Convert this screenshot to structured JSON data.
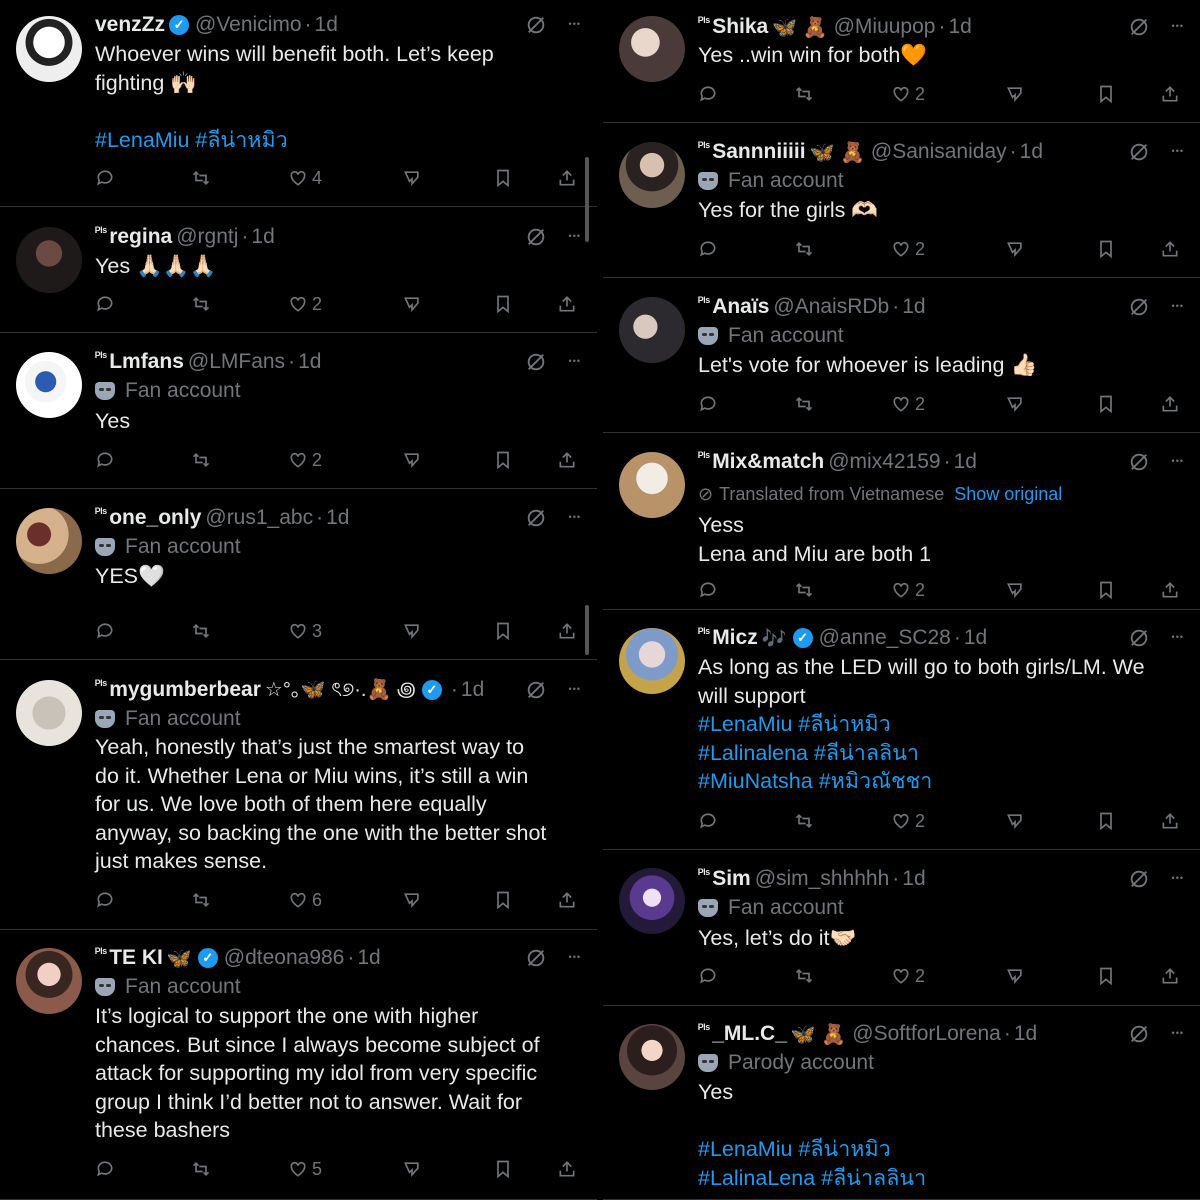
{
  "colors": {
    "background": "#000000",
    "text": "#e7e9ea",
    "muted": "#71767b",
    "accent": "#1d9bf0",
    "divider": "#2f3336"
  },
  "icons": [
    "reply-icon",
    "repost-icon",
    "like-icon",
    "stats-icon",
    "bookmark-icon",
    "share-icon",
    "grok-icon",
    "more-icon",
    "verified-icon",
    "fan-mask-icon"
  ],
  "pls_label": "ᴾˡˢ",
  "left": [
    {
      "name": "venzZz",
      "verified": true,
      "emoji": "",
      "handle": "@Venicimo",
      "time": "1d",
      "badge": "",
      "body_lines": [
        "Whoever wins will benefit both. Let’s keep",
        "fighting 🙌🏻",
        "",
        "#LenaMiu #ลีน่าหมิว"
      ],
      "likes": "4"
    },
    {
      "name": "regina",
      "verified": false,
      "emoji": "",
      "handle": "@rgntj",
      "time": "1d",
      "badge": "",
      "body_lines": [
        "Yes 🙏🏻🙏🏻🙏🏻"
      ],
      "likes": "2"
    },
    {
      "name": "Lmfans",
      "verified": false,
      "emoji": "",
      "handle": "@LMFans",
      "time": "1d",
      "badge": "Fan account",
      "body_lines": [
        "Yes"
      ],
      "likes": "2"
    },
    {
      "name": "one_only",
      "verified": false,
      "emoji": "",
      "handle": "@rus1_abc",
      "time": "1d",
      "badge": "Fan account",
      "body_lines": [
        "YES🤍"
      ],
      "likes": "3"
    },
    {
      "name": "mygumberbear",
      "verified": true,
      "emoji": "☆°｡🦋 ৎ୭·.🧸 ꩜",
      "handle": "",
      "time": "1d",
      "badge": "Fan account",
      "body_lines": [
        "Yeah, honestly that’s just the smartest way to",
        "do it. Whether Lena or Miu wins, it’s still a win",
        "for us. We love both of them here equally",
        "anyway, so backing the one with the better shot",
        "just makes sense."
      ],
      "likes": "6"
    },
    {
      "name": "TE KI",
      "verified": true,
      "emoji": "🦋",
      "handle": "@dteona986",
      "time": "1d",
      "badge": "Fan account",
      "body_lines": [
        "It’s logical to support the one with higher",
        "chances. But since I always become subject of",
        "attack for supporting my idol from very specific",
        "group I think I’d better not to answer. Wait for",
        "these bashers"
      ],
      "likes": "5"
    }
  ],
  "right": [
    {
      "name": "Shika",
      "verified": false,
      "emoji": "🦋 🧸",
      "handle": "@Miuupop",
      "time": "1d",
      "badge": "",
      "body_lines": [
        "Yes ..win win for both🧡"
      ],
      "likes": "2"
    },
    {
      "name": "Sannniiiii",
      "verified": false,
      "emoji": "🦋 🧸",
      "handle": "@Sanisaniday",
      "time": "1d",
      "badge": "Fan account",
      "body_lines": [
        "Yes for the girls 🫶🏻"
      ],
      "likes": "2"
    },
    {
      "name": "Anaïs",
      "verified": false,
      "emoji": "",
      "handle": "@AnaisRDb",
      "time": "1d",
      "badge": "Fan account",
      "body_lines": [
        "Let's vote for whoever is leading 👍🏻"
      ],
      "likes": "2"
    },
    {
      "name": "Mix&match",
      "verified": false,
      "emoji": "",
      "handle": "@mix42159",
      "time": "1d",
      "badge": "",
      "translated": "Translated from Vietnamese",
      "show_original": "Show original",
      "body_lines": [
        "Yess",
        "Lena and Miu are both 1"
      ],
      "likes": "2"
    },
    {
      "name": "Micz",
      "verified": true,
      "emoji": "🎶",
      "handle": "@anne_SC28",
      "time": "1d",
      "badge": "",
      "body_lines": [
        "As long as the LED will go to both girls/LM. We",
        "will support",
        "#LenaMiu #ลีน่าหมิว",
        "#Lalinalena #ลีน่าลลินา",
        "#MiuNatsha #หมิวณัชชา"
      ],
      "likes": "2"
    },
    {
      "name": "Sim",
      "verified": false,
      "emoji": "",
      "handle": "@sim_shhhhh",
      "time": "1d",
      "badge": "Fan account",
      "body_lines": [
        "Yes, let’s do it🤝🏻"
      ],
      "likes": "2"
    },
    {
      "name": "_ML.C_",
      "verified": false,
      "emoji": "🦋 🧸",
      "handle": "@SoftforLorena",
      "time": "1d",
      "badge": "Parody account",
      "body_lines": [
        "Yes",
        "",
        "#LenaMiu #ลีน่าหมิว",
        "#LalinaLena #ลีน่าลลินา"
      ],
      "likes": ""
    }
  ]
}
